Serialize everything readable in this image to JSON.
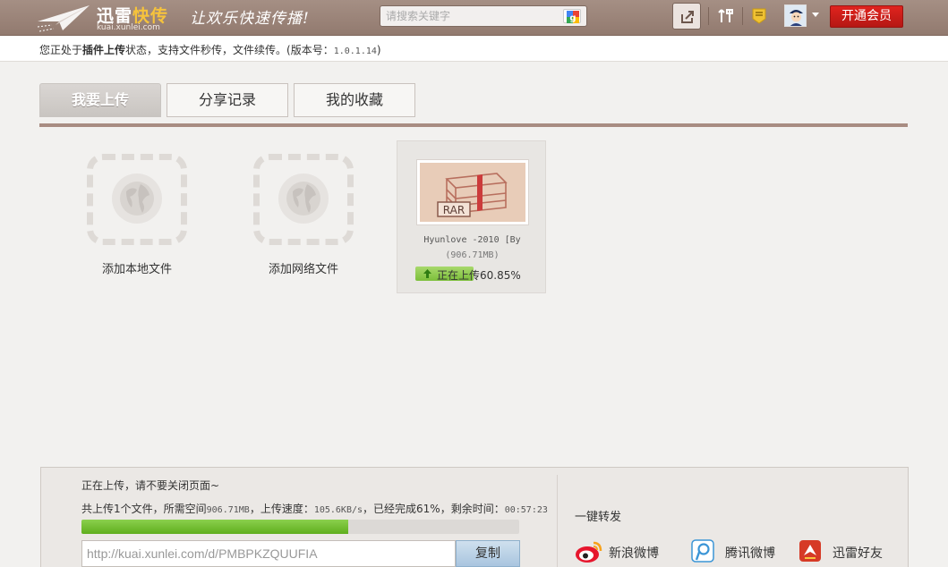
{
  "header": {
    "logo_main": "迅雷",
    "logo_accent": "快传",
    "logo_sub": "kuai.xunlei.com",
    "slogan": "让欢乐快速传播!",
    "search_placeholder": "请搜索关键字",
    "vip_button": "开通会员"
  },
  "status": {
    "prefix": "您正处于",
    "bold": "插件上传",
    "suffix": "状态，支持文件秒传，文件续传。(版本号：",
    "version": "1.0.1.14",
    "close": ")"
  },
  "tabs": [
    {
      "label": "我要上传",
      "active": true
    },
    {
      "label": "分享记录",
      "active": false
    },
    {
      "label": "我的收藏",
      "active": false
    }
  ],
  "add_tiles": [
    {
      "label": "添加本地文件"
    },
    {
      "label": "添加网络文件"
    }
  ],
  "file_card": {
    "thumb_label": "RAR",
    "name": "Hyunlove -2010 [By",
    "size": "(906.71MB)",
    "progress_text": "正在上传60.85%",
    "progress_fraction": 0.5
  },
  "bottom": {
    "title": "正在上传，请不要关闭页面~",
    "stats_a": "共上传1个文件，所需空间",
    "stats_space": "906.71MB",
    "stats_b": "，上传速度：",
    "stats_speed": "105.6KB/s",
    "stats_c": "，已经完成61%",
    "stats_d": "，剩余时间：",
    "stats_time": "00:57:23",
    "progress_fraction": 0.61,
    "link_url": "http://kuai.xunlei.com/d/PMBPKZQUUFIA",
    "copy_label": "复制",
    "share_title": "一键转发",
    "share_items": [
      {
        "label": "新浪微博",
        "icon": "sina-weibo-icon",
        "color": "#e6162d"
      },
      {
        "label": "腾讯微博",
        "icon": "tencent-weibo-icon",
        "color": "#3b95d6"
      },
      {
        "label": "迅雷好友",
        "icon": "xunlei-friends-icon",
        "color": "#d63a26"
      }
    ]
  },
  "colors": {
    "header_bg": "#9d867b",
    "tab_rule": "#a88c82",
    "vip_red": "#d11f1a",
    "progress_green": "#6cb92a"
  }
}
